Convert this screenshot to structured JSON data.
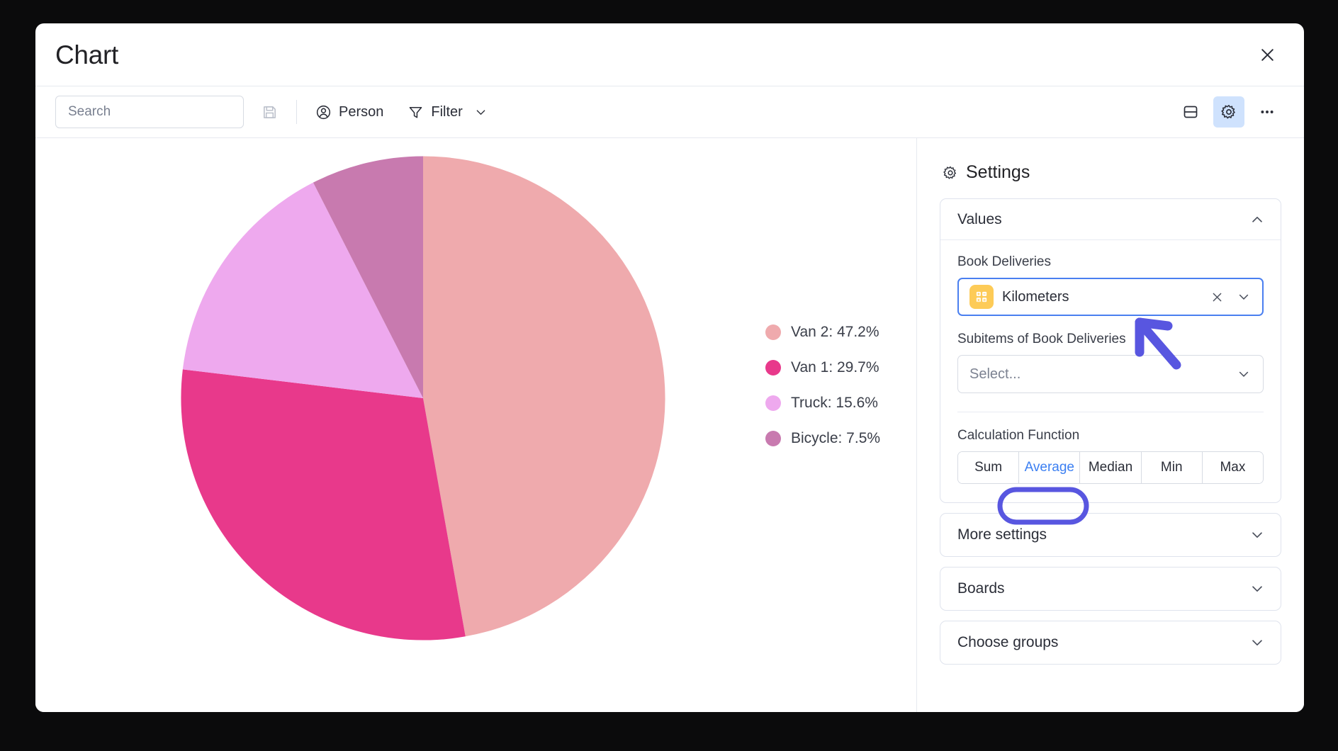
{
  "window": {
    "title": "Chart",
    "close_icon": "close-icon"
  },
  "toolbar": {
    "search": {
      "placeholder": "Search",
      "value": "",
      "icon": "search-icon"
    },
    "save_icon": "save-disk-icon",
    "person": {
      "label": "Person",
      "icon": "person-circle-icon"
    },
    "filter": {
      "label": "Filter",
      "icon": "funnel-icon",
      "chevron": "chevron-down-icon"
    },
    "layout_icon": "split-layout-icon",
    "settings_icon": "gear-icon",
    "more_icon": "more-horizontal-icon"
  },
  "settings": {
    "title": "Settings",
    "header_icon": "gear-icon",
    "values_card": {
      "title": "Values",
      "chevron": "chevron-up-icon",
      "book_deliveries_label": "Book Deliveries",
      "book_deliveries_value": "Kilometers",
      "book_deliveries_icon": "formula-grid-icon",
      "clear_icon": "close-icon",
      "chevron_down": "chevron-down-icon",
      "subitems_label": "Subitems of Book Deliveries",
      "subitems_placeholder": "Select...",
      "calculation_label": "Calculation Function",
      "calculation_options": [
        "Sum",
        "Average",
        "Median",
        "Min",
        "Max"
      ],
      "calculation_selected": "Average"
    },
    "collapsed_sections": [
      {
        "title": "More settings",
        "chevron": "chevron-down-icon"
      },
      {
        "title": "Boards",
        "chevron": "chevron-down-icon"
      },
      {
        "title": "Choose groups",
        "chevron": "chevron-down-icon"
      }
    ]
  },
  "colors": {
    "accent_blue": "#4a7ff0",
    "selected_text_blue": "#3b7ff2",
    "annotation_purple": "#5856e0",
    "gear_active_bg": "#cfe2fd",
    "value_icon_yellow": "#fdcb57"
  },
  "chart_data": {
    "type": "pie",
    "title": "",
    "legend_position": "right",
    "start_angle_deg": 0,
    "direction": "clockwise",
    "categories": [
      "Van 2",
      "Van 1",
      "Truck",
      "Bicycle"
    ],
    "values": [
      47.2,
      29.7,
      15.6,
      7.5
    ],
    "unit": "%",
    "colors": [
      "#EFAAAD",
      "#E8398B",
      "#EEA9EE",
      "#C87AAF"
    ],
    "legend_entries": [
      {
        "label": "Van 2: 47.2%",
        "color": "#EFAAAD",
        "value": 47.2
      },
      {
        "label": "Van 1: 29.7%",
        "color": "#E8398B",
        "value": 29.7
      },
      {
        "label": "Truck: 15.6%",
        "color": "#EEA9EE",
        "value": 15.6
      },
      {
        "label": "Bicycle: 7.5%",
        "color": "#C87AAF",
        "value": 7.5
      }
    ]
  }
}
